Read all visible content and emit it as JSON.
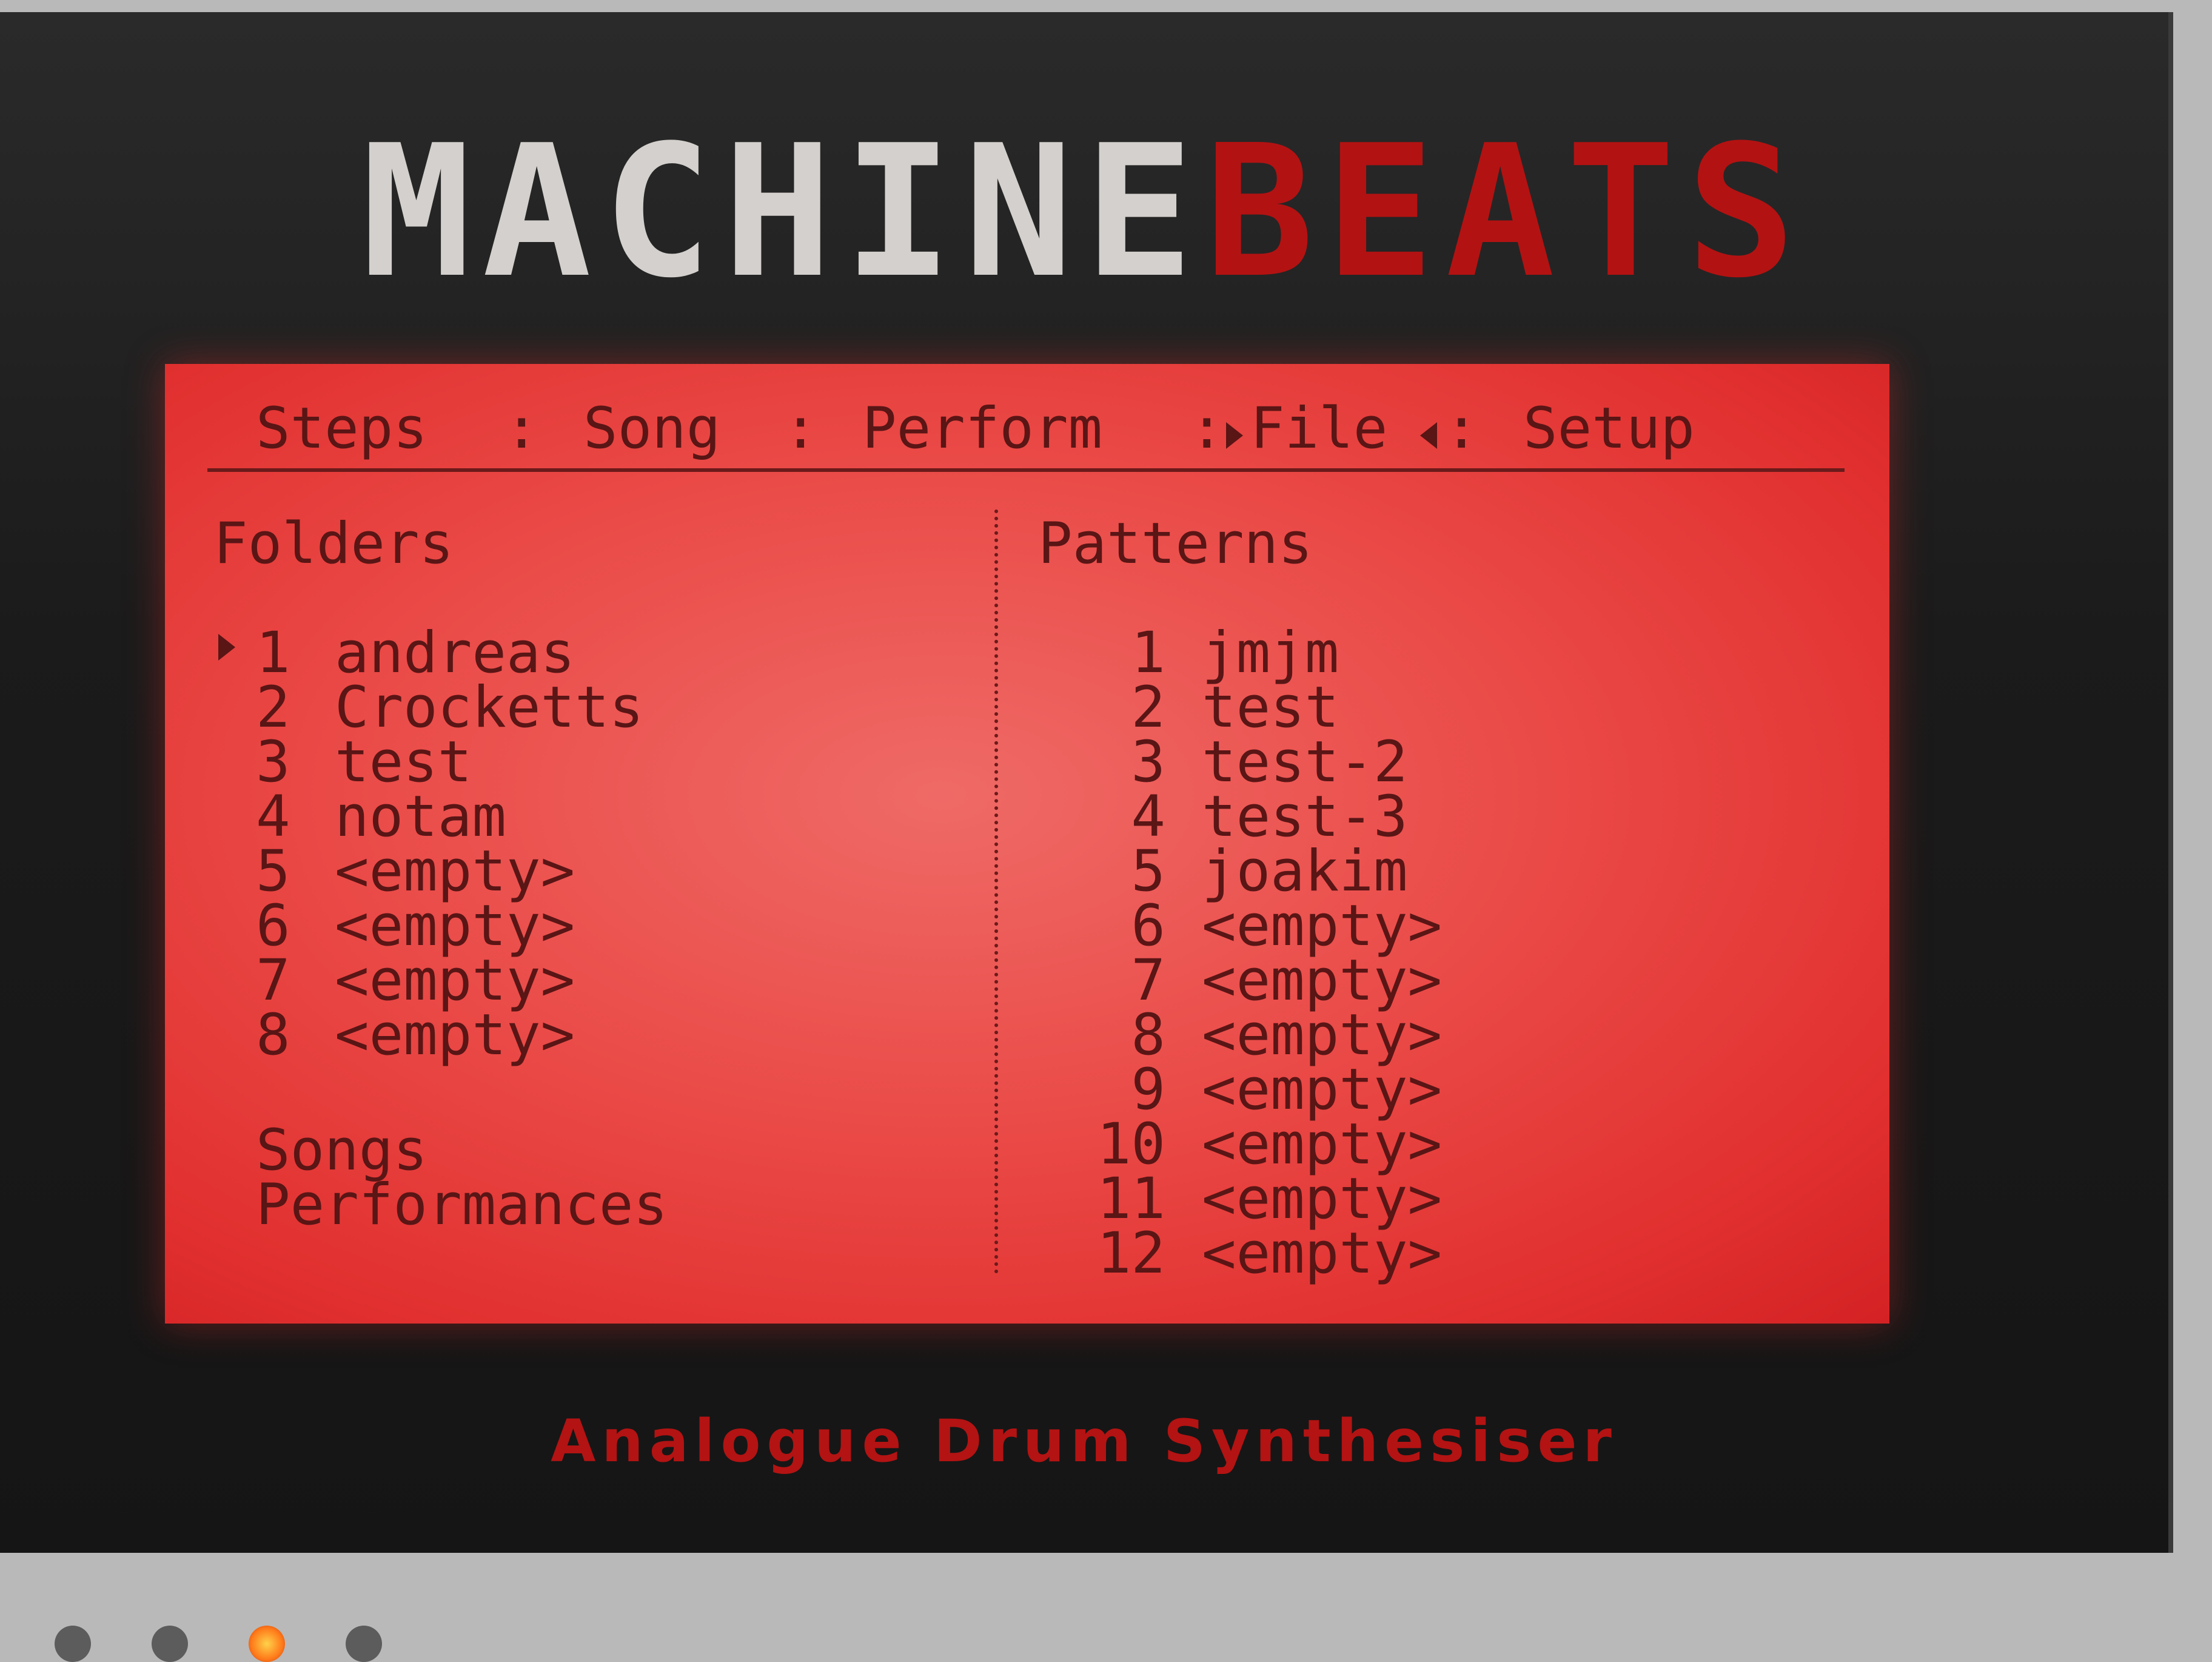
{
  "logo": {
    "part1": "MACHINE",
    "part2": "BEATS"
  },
  "menu": {
    "steps": "Steps",
    "song": "Song",
    "perform": "Perform",
    "file": "File",
    "setup": "Setup",
    "separator": ":",
    "active": "File"
  },
  "folders": {
    "title": "Folders",
    "selected_index": 1,
    "items": [
      {
        "num": "1",
        "name": "andreas"
      },
      {
        "num": "2",
        "name": "Crocketts"
      },
      {
        "num": "3",
        "name": "test"
      },
      {
        "num": "4",
        "name": "notam"
      },
      {
        "num": "5",
        "name": "<empty>"
      },
      {
        "num": "6",
        "name": "<empty>"
      },
      {
        "num": "7",
        "name": "<empty>"
      },
      {
        "num": "8",
        "name": "<empty>"
      }
    ],
    "extra": [
      "Songs",
      "Performances"
    ]
  },
  "patterns": {
    "title": "Patterns",
    "items": [
      {
        "num": "1",
        "name": "jmjm"
      },
      {
        "num": "2",
        "name": "test"
      },
      {
        "num": "3",
        "name": "test-2"
      },
      {
        "num": "4",
        "name": "test-3"
      },
      {
        "num": "5",
        "name": "joakim"
      },
      {
        "num": "6",
        "name": "<empty>"
      },
      {
        "num": "7",
        "name": "<empty>"
      },
      {
        "num": "8",
        "name": "<empty>"
      },
      {
        "num": "9",
        "name": "<empty>"
      },
      {
        "num": "10",
        "name": "<empty>"
      },
      {
        "num": "11",
        "name": "<empty>"
      },
      {
        "num": "12",
        "name": "<empty>"
      }
    ]
  },
  "tagline": "Analogue Drum Synthesiser",
  "colors": {
    "lcd": "#ea4a47",
    "text": "#5a1515",
    "brand_red": "#b31212"
  }
}
